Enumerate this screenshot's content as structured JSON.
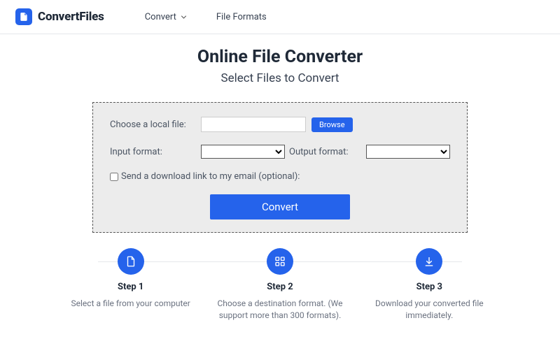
{
  "brand": "ConvertFiles",
  "nav": {
    "convert": "Convert",
    "formats": "File Formats"
  },
  "hero": {
    "title": "Online File Converter",
    "subtitle": "Select Files to Convert"
  },
  "panel": {
    "choose": "Choose a local file:",
    "browse": "Browse",
    "input": "Input format:",
    "output": "Output format:",
    "email": "Send a download link to my email (optional):",
    "convert": "Convert"
  },
  "steps": [
    {
      "title": "Step 1",
      "desc": "Select a file from your computer"
    },
    {
      "title": "Step 2",
      "desc": "Choose a destination format. (We support more than 300 formats)."
    },
    {
      "title": "Step 3",
      "desc": "Download your converted file immediately."
    }
  ]
}
